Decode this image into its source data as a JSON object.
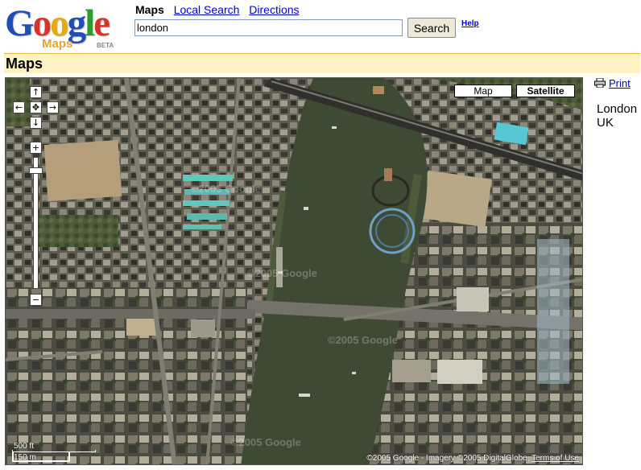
{
  "logo": {
    "google_letters": [
      {
        "ch": "G",
        "color": "#1f4eb7"
      },
      {
        "ch": "o",
        "color": "#d6342a"
      },
      {
        "ch": "o",
        "color": "#e8a90f"
      },
      {
        "ch": "g",
        "color": "#1f4eb7"
      },
      {
        "ch": "l",
        "color": "#2d9b2d"
      },
      {
        "ch": "e",
        "color": "#d6342a"
      }
    ],
    "sub": "Maps",
    "beta": "BETA"
  },
  "nav": {
    "current": "Maps",
    "links": [
      "Local Search",
      "Directions"
    ]
  },
  "search": {
    "value": "london",
    "button": "Search",
    "help": "Help"
  },
  "page_title": "Maps",
  "map": {
    "type_buttons": {
      "map": "Map",
      "satellite": "Satellite"
    },
    "selected_type": "Satellite",
    "pan": {
      "up": "↑",
      "left": "←",
      "center": "✥",
      "right": "→",
      "down": "↓"
    },
    "zoom": {
      "in": "+",
      "out": "−",
      "level_fraction": 0.08
    },
    "scale": {
      "imperial": "500 ft",
      "metric": "150 m"
    },
    "copyright_text": "©2005 Google - Imagery ©2005 DigitalGlobe,",
    "terms": "Terms of Use",
    "watermark": "©2005 Google"
  },
  "side": {
    "print": "Print",
    "location_line1": "London",
    "location_line2": "UK"
  },
  "colors": {
    "link": "#0000cc",
    "title_bar": "#fff3c3",
    "title_border": "#e5b948",
    "river": "#3f4a35"
  }
}
